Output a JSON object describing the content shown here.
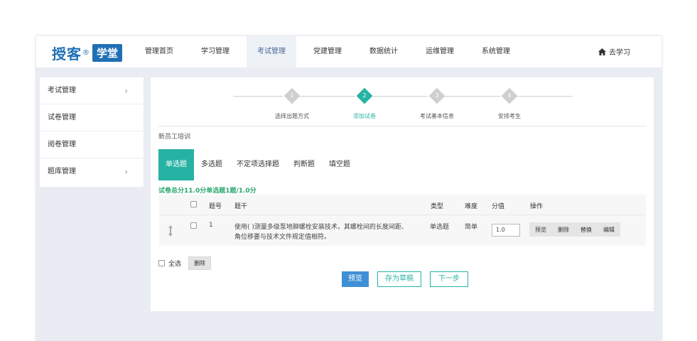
{
  "logo": {
    "text": "授客",
    "reg": "®",
    "badge": "学堂"
  },
  "nav": {
    "items": [
      "管理首页",
      "学习管理",
      "考试管理",
      "党建管理",
      "数据统计",
      "运维管理",
      "系统管理"
    ],
    "active": "考试管理",
    "goto_label": "去学习",
    "goto_icon": "home-icon"
  },
  "sidebar": {
    "items": [
      {
        "label": "考试管理",
        "arrow": "›"
      },
      {
        "label": "试卷管理",
        "arrow": ""
      },
      {
        "label": "阅卷管理",
        "arrow": ""
      },
      {
        "label": "题库管理",
        "arrow": "›"
      }
    ]
  },
  "steps": [
    {
      "num": "1",
      "label": "选择出题方式",
      "active": false
    },
    {
      "num": "2",
      "label": "添加试卷",
      "active": true
    },
    {
      "num": "3",
      "label": "考试基本信息",
      "active": false
    },
    {
      "num": "4",
      "label": "安排考生",
      "active": false
    }
  ],
  "paper": {
    "title": "新员工培训",
    "summary": "试卷总分11.0分单选题1题/1.0分"
  },
  "tabs": [
    "单选题",
    "多选题",
    "不定项选择题",
    "判断题",
    "填空题"
  ],
  "table": {
    "headers": {
      "num": "题号",
      "stem": "题干",
      "type": "类型",
      "difficulty": "难度",
      "score": "分值",
      "ops": "操作"
    },
    "rows": [
      {
        "num": "1",
        "stem_line1": "使用( )测量多级泵地脚螺栓安装技术，其螺栓间的长度间距、",
        "stem_line2": "角位移要与技术文件规定值相符。",
        "type": "单选题",
        "difficulty": "简单",
        "score": "1.0",
        "ops": [
          "预览",
          "删除",
          "替换",
          "编辑"
        ]
      }
    ]
  },
  "footer": {
    "select_all": "全选",
    "delete": "删除",
    "preview": "预览",
    "save_draft": "存为草稿",
    "next": "下一步"
  },
  "colors": {
    "accent": "#27b3a3",
    "brand": "#1f6fb5",
    "primary": "#3f8fd6",
    "summary": "#2da86f"
  }
}
